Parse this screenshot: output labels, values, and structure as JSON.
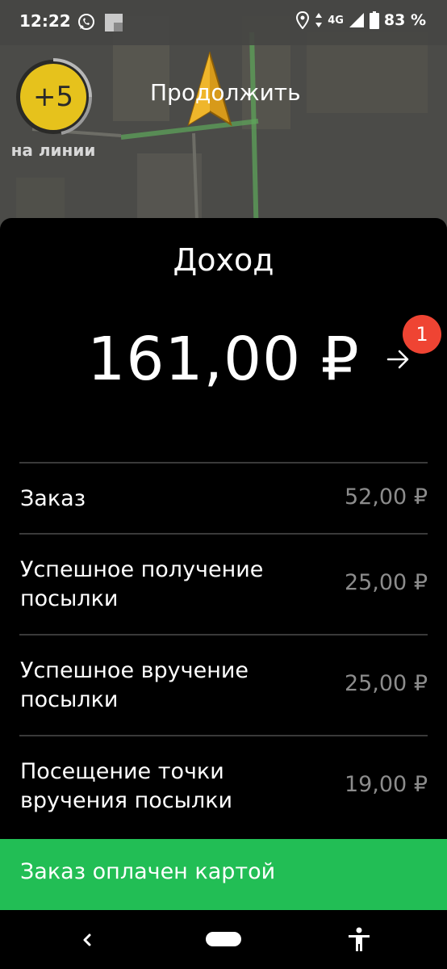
{
  "status_bar": {
    "time": "12:22",
    "network": "4G",
    "battery": "83 %"
  },
  "map": {
    "gauge_value": "+5",
    "gauge_label": "на линии",
    "continue_label": "Продолжить"
  },
  "income": {
    "title": "Доход",
    "total": "161,00 ₽",
    "badge_count": "1"
  },
  "items": [
    {
      "label": "Заказ",
      "value": "52,00 ₽"
    },
    {
      "label": "Успешное получение посылки",
      "value": "25,00 ₽"
    },
    {
      "label": "Успешное вручение посылки",
      "value": "25,00 ₽"
    },
    {
      "label": "Посещение точки вручения посылки",
      "value": "19,00 ₽"
    }
  ],
  "payment": {
    "label": "Заказ оплачен картой"
  },
  "colors": {
    "accent_green": "#22be55",
    "badge_red": "#ef4433",
    "gauge_yellow": "#e6c21c"
  },
  "icons": [
    "whatsapp-icon",
    "app-icon",
    "location-icon",
    "signal-icon",
    "battery-icon",
    "navigation-arrow-icon",
    "arrow-right-icon",
    "back-icon",
    "home-icon",
    "accessibility-icon"
  ]
}
